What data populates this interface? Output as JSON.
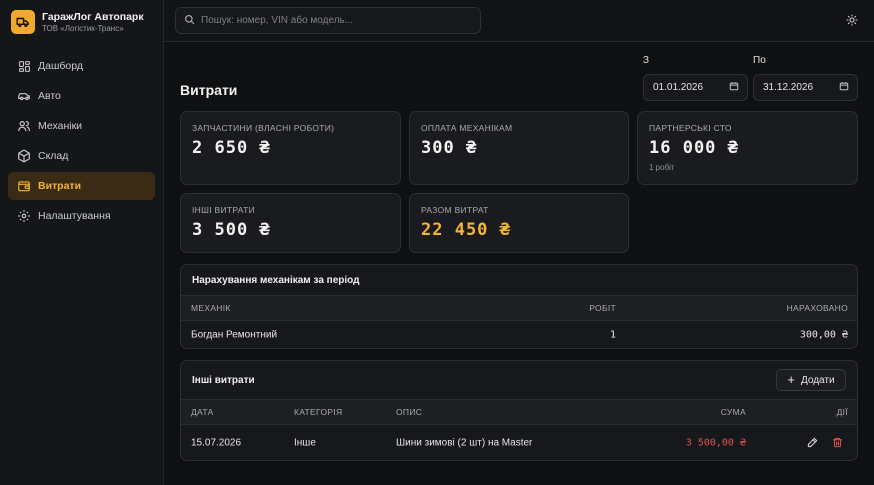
{
  "brand": {
    "title": "ГаражЛог Автопарк",
    "subtitle": "ТОВ «Логістик-Транс»"
  },
  "search": {
    "placeholder": "Пошук: номер, VIN або модель..."
  },
  "nav": [
    {
      "label": "Дашборд",
      "icon": "dashboard-icon",
      "active": false
    },
    {
      "label": "Авто",
      "icon": "car-icon",
      "active": false
    },
    {
      "label": "Механіки",
      "icon": "users-icon",
      "active": false
    },
    {
      "label": "Склад",
      "icon": "box-icon",
      "active": false
    },
    {
      "label": "Витрати",
      "icon": "wallet-icon",
      "active": true
    },
    {
      "label": "Налаштування",
      "icon": "gear-icon",
      "active": false
    }
  ],
  "page": {
    "title": "Витрати"
  },
  "dates": {
    "from_label": "З",
    "from_value": "01.01.2026",
    "to_label": "По",
    "to_value": "31.12.2026"
  },
  "cards": {
    "parts": {
      "label": "ЗАПЧАСТИНИ (ВЛАСНІ РОБОТИ)",
      "value": "2 650 ₴"
    },
    "mechanics_pay": {
      "label": "ОПЛАТА МЕХАНІКАМ",
      "value": "300 ₴"
    },
    "partner": {
      "label": "ПАРТНЕРСЬКІ СТО",
      "value": "16 000 ₴",
      "note": "1 робіт"
    },
    "other": {
      "label": "ІНШІ ВИТРАТИ",
      "value": "3 500 ₴"
    },
    "total": {
      "label": "РАЗОМ ВИТРАТ",
      "value": "22 450 ₴"
    }
  },
  "accruals": {
    "title": "Нарахування механікам за період",
    "columns": [
      "МЕХАНІК",
      "РОБІТ",
      "НАРАХОВАНО"
    ],
    "rows": [
      {
        "mechanic": "Богдан Ремонтний",
        "jobs": "1",
        "amount": "300,00 ₴"
      }
    ]
  },
  "other_expenses": {
    "title": "Інші витрати",
    "add_label": "Додати",
    "columns": [
      "ДАТА",
      "КАТЕГОРІЯ",
      "ОПИС",
      "СУМА",
      "ДІЇ"
    ],
    "rows": [
      {
        "date": "15.07.2026",
        "category": "Інше",
        "description": "Шини зимові (2 шт) на Master",
        "amount": "3 500,00 ₴"
      }
    ]
  },
  "colors": {
    "accent": "#f3b634",
    "danger": "#e05252",
    "background": "#0f1012"
  }
}
